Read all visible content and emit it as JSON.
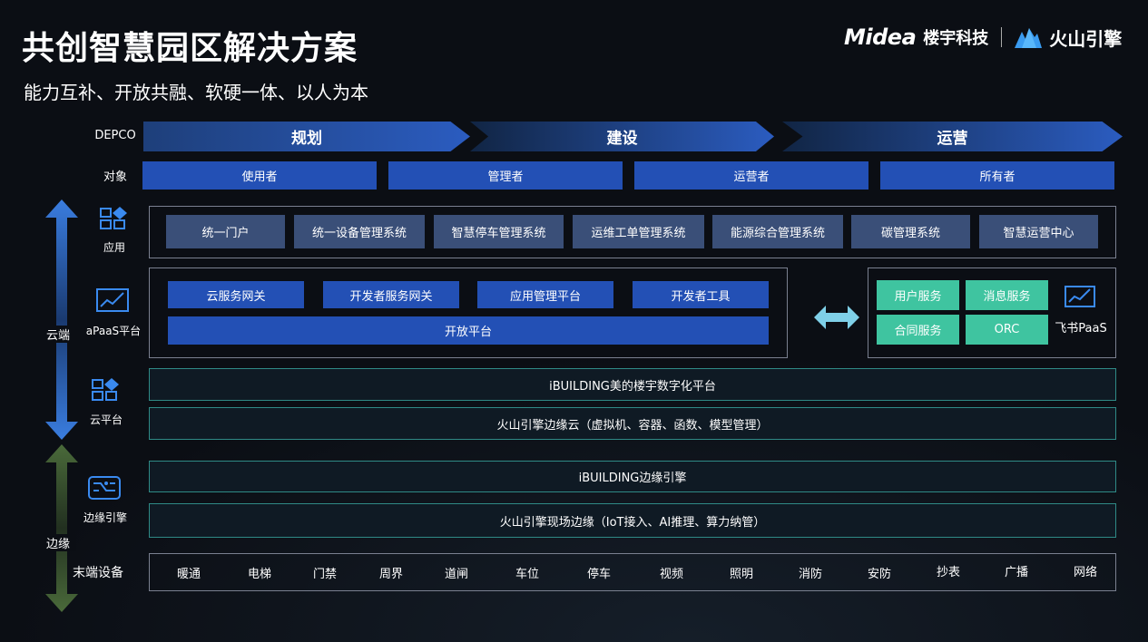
{
  "header": {
    "title": "共创智慧园区解决方案",
    "subtitle": "能力互补、开放共融、软硬一体、以人为本",
    "logo_midea": "Midea",
    "logo_midea_suffix": "楼宇科技",
    "logo_volc": "火山引擎"
  },
  "row_labels": {
    "depco": "DEPCO",
    "audience": "对象",
    "app": "应用",
    "apaas": "aPaaS平台",
    "cloud_platform": "云平台",
    "edge_engine": "边缘引擎",
    "end_devices": "末端设备",
    "cloud_side": "云端",
    "edge_side": "边缘"
  },
  "phases": [
    "规划",
    "建设",
    "运营"
  ],
  "audiences": [
    "使用者",
    "管理者",
    "运营者",
    "所有者"
  ],
  "apps": [
    "统一门户",
    "统一设备管理系统",
    "智慧停车管理系统",
    "运维工单管理系统",
    "能源综合管理系统",
    "碳管理系统",
    "智慧运营中心"
  ],
  "apaas": {
    "modules": [
      "云服务网关",
      "开发者服务网关",
      "应用管理平台",
      "开发者工具"
    ],
    "open_platform": "开放平台",
    "feishu_services": [
      "用户服务",
      "消息服务",
      "合同服务",
      "ORC"
    ],
    "feishu_label": "飞书PaaS"
  },
  "cloud_bars": [
    "iBUILDING美的楼宇数字化平台",
    "火山引擎边缘云（虚拟机、容器、函数、模型管理）"
  ],
  "edge_bars": [
    "iBUILDING边缘引擎",
    "火山引擎现场边缘（IoT接入、AI推理、算力纳管）"
  ],
  "devices": [
    "暖通",
    "电梯",
    "门禁",
    "周界",
    "道闸",
    "车位",
    "停车",
    "视频",
    "照明",
    "消防",
    "安防",
    "抄表",
    "广播",
    "网络"
  ],
  "colors": {
    "background": "#0b0e14",
    "primary_blue": "#2350b5",
    "app_box": "#3a4f78",
    "feishu_green": "#3fc4a0",
    "bar_border": "#2f8a86",
    "cloud_arrow": "#3a7de0",
    "edge_arrow": "#4a6a3a"
  }
}
